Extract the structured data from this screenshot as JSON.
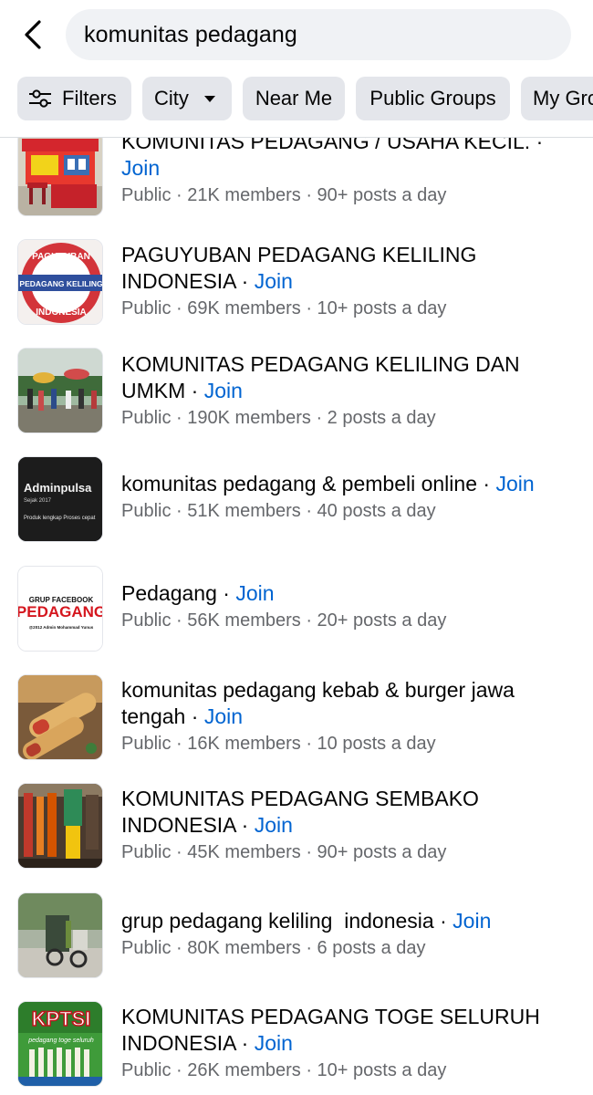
{
  "search": {
    "query": "komunitas pedagang"
  },
  "icons": {
    "back": "chevron-left-icon",
    "filters": "sliders-icon",
    "city_caret": "caret-down-icon"
  },
  "colors": {
    "join": "#0064d1",
    "meta": "#65676b",
    "chip_bg": "#e4e6eb",
    "search_bg": "#f0f2f5"
  },
  "chips": [
    {
      "label": "Filters"
    },
    {
      "label": "City"
    },
    {
      "label": "Near Me"
    },
    {
      "label": "Public Groups"
    },
    {
      "label": "My Gro"
    }
  ],
  "join_label": "Join",
  "separator": " · ",
  "groups": [
    {
      "name": "KOMUNITAS PEDAGANG / USAHA KECIL.",
      "privacy": "Public",
      "members": "21K members",
      "activity": "90+ posts a day"
    },
    {
      "name": "PAGUYUBAN PEDAGANG KELILING INDONESIA",
      "privacy": "Public",
      "members": "69K members",
      "activity": "10+ posts a day",
      "thumb_text_top": "PAGUYUBAN",
      "thumb_text_mid": "PEDAGANG KELILING",
      "thumb_text_bottom": "INDONESIA"
    },
    {
      "name": "KOMUNITAS PEDAGANG KELILING DAN UMKM",
      "privacy": "Public",
      "members": "190K members",
      "activity": "2 posts a day"
    },
    {
      "name": "komunitas pedagang & pembeli online",
      "privacy": "Public",
      "members": "51K members",
      "activity": "40 posts a day",
      "thumb_text_top": "Adminpulsa",
      "thumb_text_mid": "Sejak 2017",
      "thumb_text_bottom": "Produk lengkap  Proses cepat"
    },
    {
      "name": "Pedagang",
      "privacy": "Public",
      "members": "56K members",
      "activity": "20+ posts a day",
      "thumb_text_top": "GRUP FACEBOOK",
      "thumb_text_mid": "PEDAGANG",
      "thumb_text_bottom": "@2012 Admin Mohammad Yunus"
    },
    {
      "name": "komunitas pedagang kebab & burger jawa tengah",
      "privacy": "Public",
      "members": "16K members",
      "activity": "10 posts a day"
    },
    {
      "name": "KOMUNITAS PEDAGANG SEMBAKO INDONESIA",
      "privacy": "Public",
      "members": "45K members",
      "activity": "90+ posts a day"
    },
    {
      "name": "grup pedagang keliling  indonesia",
      "privacy": "Public",
      "members": "80K members",
      "activity": "6 posts a day"
    },
    {
      "name": "KOMUNITAS PEDAGANG TOGE SELURUH INDONESIA",
      "privacy": "Public",
      "members": "26K members",
      "activity": "10+ posts a day",
      "thumb_text_top": "KPTSI",
      "thumb_text_mid": "pedagang toge seluruh"
    }
  ]
}
